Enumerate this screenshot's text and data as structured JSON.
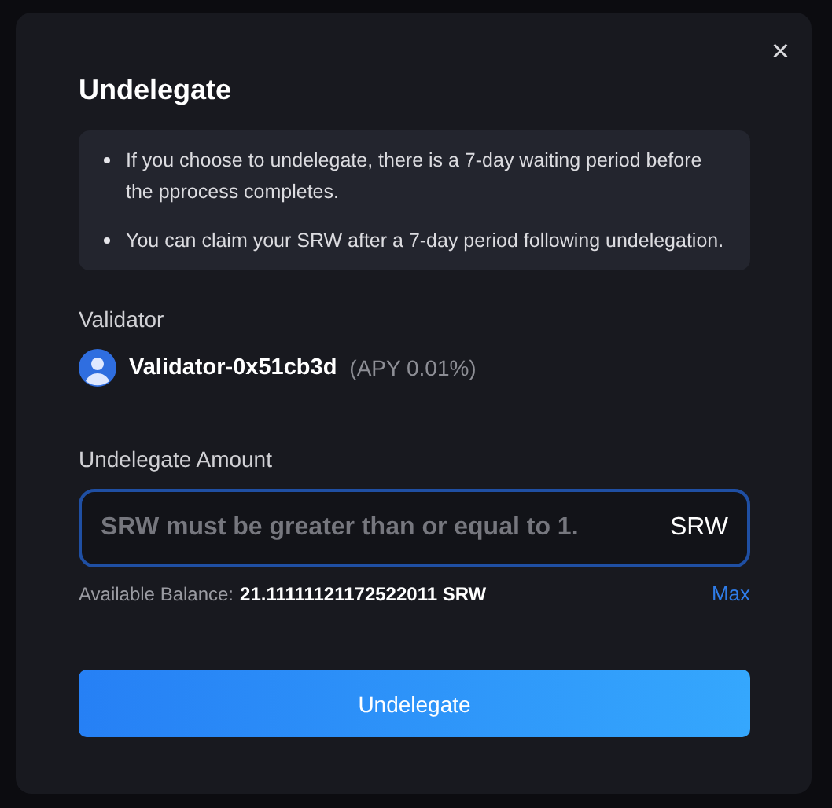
{
  "dialog": {
    "title": "Undelegate",
    "close": "×",
    "notes": [
      "If you choose to undelegate, there is a 7-day waiting period before the pprocess completes.",
      "You can claim your SRW after a 7-day period following undelegation."
    ],
    "validator": {
      "label": "Validator",
      "name": "Validator-0x51cb3d",
      "apy": "(APY 0.01%)"
    },
    "amount": {
      "label": "Undelegate Amount",
      "placeholder": "SRW must be greater than or equal to 1.",
      "unit": "SRW",
      "focused": true
    },
    "balance": {
      "label": "Available Balance:",
      "value": "21.11111121172522011 SRW",
      "max": "Max"
    },
    "submit": "Undelegate"
  }
}
